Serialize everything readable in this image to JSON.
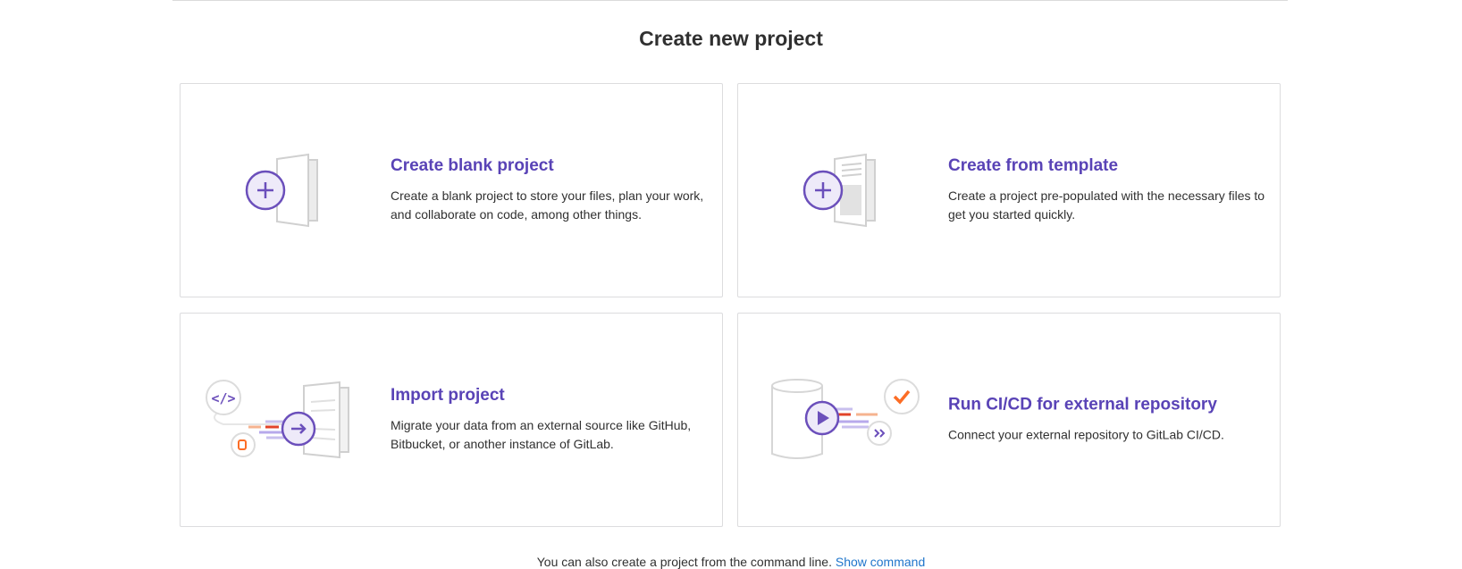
{
  "page": {
    "title": "Create new project"
  },
  "cards": {
    "blank": {
      "title": "Create blank project",
      "description": "Create a blank project to store your files, plan your work, and collaborate on code, among other things."
    },
    "template": {
      "title": "Create from template",
      "description": "Create a project pre-populated with the necessary files to get you started quickly."
    },
    "import": {
      "title": "Import project",
      "description": "Migrate your data from an external source like GitHub, Bitbucket, or another instance of GitLab."
    },
    "cicd": {
      "title": "Run CI/CD for external repository",
      "description": "Connect your external repository to GitLab CI/CD."
    }
  },
  "footer": {
    "text": "You can also create a project from the command line.",
    "link": "Show command"
  },
  "colors": {
    "accent": "#5943b6",
    "link": "#1f75cb",
    "orange": "#e24329",
    "border": "#dcdcde"
  },
  "icons": {
    "blank": "blank-project-illustration-icon",
    "template": "template-project-illustration-icon",
    "import": "import-project-illustration-icon",
    "cicd": "cicd-illustration-icon"
  }
}
